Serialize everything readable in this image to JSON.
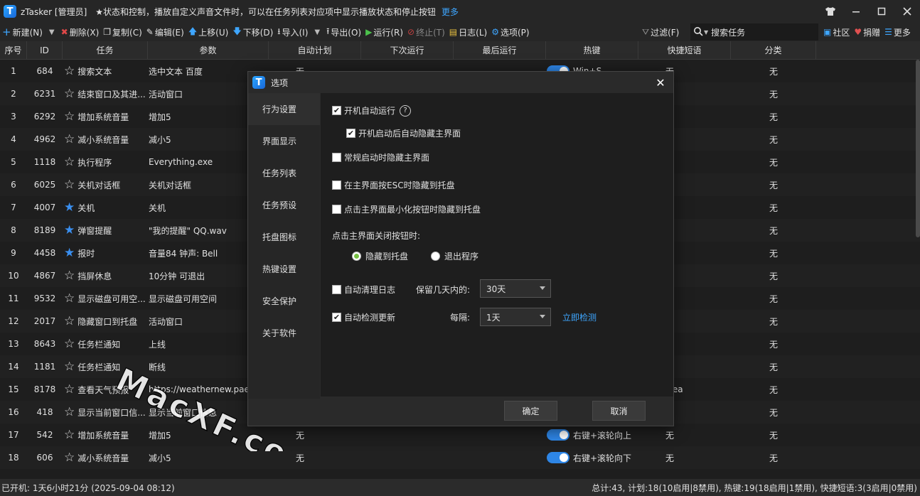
{
  "window": {
    "app_title": "zTasker [管理员]",
    "description": "★状态和控制，播放自定义声音文件时，可以在任务列表对应项中显示播放状态和停止按钮",
    "more_link": "更多",
    "logo_letter": "T"
  },
  "toolbar": {
    "new": "新建(N)",
    "delete": "删除(X)",
    "copy": "复制(C)",
    "edit": "编辑(E)",
    "up": "上移(U)",
    "down": "下移(D)",
    "import": "导入(I)",
    "export": "导出(O)",
    "run": "运行(R)",
    "stop": "终止(T)",
    "log": "日志(L)",
    "options": "选项(P)",
    "filter": "过滤(F)",
    "search_placeholder": "搜索任务",
    "community": "社区",
    "donate": "捐赠",
    "more": "更多"
  },
  "table": {
    "headers": [
      "序号",
      "ID",
      "任务",
      "参数",
      "自动计划",
      "下次运行",
      "最后运行",
      "热键",
      "快捷短语",
      "分类"
    ],
    "rows": [
      {
        "no": "1",
        "id": "684",
        "task": "搜索文本",
        "param": "选中文本 百度",
        "auto": "无",
        "hotkey": "Win+S",
        "phrase": "无",
        "cat": "无",
        "star": "white"
      },
      {
        "no": "2",
        "id": "6231",
        "task": "结束窗口及其进...",
        "param": "活动窗口",
        "auto": "",
        "hotkey": "",
        "phrase": "",
        "cat": "无",
        "star": "white"
      },
      {
        "no": "3",
        "id": "6292",
        "task": "增加系统音量",
        "param": "增加5",
        "auto": "",
        "hotkey": "",
        "phrase": "",
        "cat": "无",
        "star": "white"
      },
      {
        "no": "4",
        "id": "4962",
        "task": "减小系统音量",
        "param": "减小5",
        "auto": "",
        "hotkey": "",
        "phrase": "",
        "cat": "无",
        "star": "white"
      },
      {
        "no": "5",
        "id": "1118",
        "task": "执行程序",
        "param": "Everything.exe",
        "auto": "",
        "hotkey": "",
        "phrase": "",
        "cat": "无",
        "star": "white"
      },
      {
        "no": "6",
        "id": "6025",
        "task": "关机对话框",
        "param": "关机对话框",
        "auto": "",
        "hotkey": "",
        "phrase": "",
        "cat": "无",
        "star": "white"
      },
      {
        "no": "7",
        "id": "4007",
        "task": "关机",
        "param": "关机",
        "auto": "",
        "hotkey": "",
        "phrase": "",
        "cat": "无",
        "star": "blue"
      },
      {
        "no": "8",
        "id": "8189",
        "task": "弹窗提醒",
        "param": "\"我的提醒\" QQ.wav",
        "auto": "",
        "hotkey": "",
        "phrase": "",
        "cat": "无",
        "star": "blue"
      },
      {
        "no": "9",
        "id": "4458",
        "task": "报时",
        "param": "音量84 钟声: Bell",
        "auto": "",
        "hotkey": "",
        "phrase": "",
        "cat": "无",
        "star": "blue"
      },
      {
        "no": "10",
        "id": "4867",
        "task": "挡屏休息",
        "param": "10分钟 可退出",
        "auto": "",
        "hotkey": "",
        "phrase": "",
        "cat": "无",
        "star": "white"
      },
      {
        "no": "11",
        "id": "9532",
        "task": "显示磁盘可用空...",
        "param": "显示磁盘可用空间",
        "auto": "",
        "hotkey": "",
        "phrase": "",
        "cat": "无",
        "star": "white"
      },
      {
        "no": "12",
        "id": "2017",
        "task": "隐藏窗口到托盘",
        "param": "活动窗口",
        "auto": "",
        "hotkey": "",
        "phrase": "",
        "cat": "无",
        "star": "white"
      },
      {
        "no": "13",
        "id": "8643",
        "task": "任务栏通知",
        "param": "上线",
        "auto": "",
        "hotkey": "",
        "phrase": "",
        "cat": "无",
        "star": "white"
      },
      {
        "no": "14",
        "id": "1181",
        "task": "任务栏通知",
        "param": "断线",
        "auto": "",
        "hotkey": "",
        "phrase": "",
        "cat": "无",
        "star": "white"
      },
      {
        "no": "15",
        "id": "8178",
        "task": "查看天气预报",
        "param": "https://weathernew.pae...",
        "auto": "",
        "hotkey": "",
        "phrase": "wea",
        "cat": "无",
        "star": "white"
      },
      {
        "no": "16",
        "id": "418",
        "task": "显示当前窗口信...",
        "param": "显示当前窗口信息",
        "auto": "",
        "hotkey": "",
        "phrase": "",
        "cat": "无",
        "star": "white"
      },
      {
        "no": "17",
        "id": "542",
        "task": "增加系统音量",
        "param": "增加5",
        "auto": "无",
        "hotkey": "右键+滚轮向上",
        "phrase": "无",
        "cat": "无",
        "star": "white"
      },
      {
        "no": "18",
        "id": "606",
        "task": "减小系统音量",
        "param": "减小5",
        "auto": "无",
        "hotkey": "右键+滚轮向下",
        "phrase": "无",
        "cat": "无",
        "star": "white"
      }
    ]
  },
  "status": {
    "left": "已开机: 1天6小时21分 (2025-09-04 08:12)",
    "right": "总计:43, 计划:18(10启用|8禁用), 热键:19(18启用|1禁用), 快捷短语:3(3启用|0禁用)"
  },
  "watermark": "MacXF.com",
  "dialog": {
    "title": "选项",
    "nav": [
      "行为设置",
      "界面显示",
      "任务列表",
      "任务预设",
      "托盘图标",
      "热键设置",
      "安全保护",
      "关于软件"
    ],
    "opt_autostart": "开机自动运行",
    "opt_autostart_hide": "开机启动后自动隐藏主界面",
    "opt_normal_hide": "常规启动时隐藏主界面",
    "opt_esc_tray": "在主界面按ESC时隐藏到托盘",
    "opt_min_tray": "点击主界面最小化按钮时隐藏到托盘",
    "close_label": "点击主界面关闭按钮时:",
    "radio_tray": "隐藏到托盘",
    "radio_exit": "退出程序",
    "opt_clean_log": "自动清理日志",
    "keep_days_label": "保留几天内的:",
    "keep_days_value": "30天",
    "opt_check_update": "自动检测更新",
    "interval_label": "每隔:",
    "interval_value": "1天",
    "check_now": "立即检测",
    "ok": "确定",
    "cancel": "取消"
  }
}
